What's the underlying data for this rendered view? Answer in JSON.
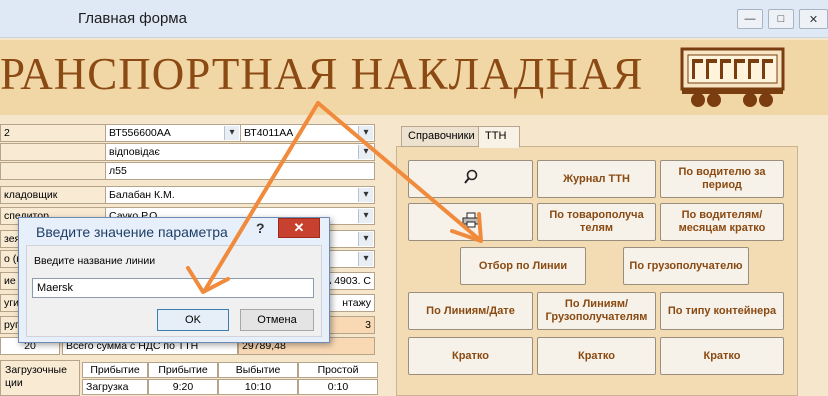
{
  "window": {
    "title": "Главная форма",
    "min": "—",
    "max": "□",
    "close": "✕"
  },
  "banner": {
    "text": "РАНСПОРТНАЯ НАКЛАДНАЯ"
  },
  "form": {
    "r1_label": "2",
    "r1_combo_a": "ВТ556600АА",
    "r1_combo_b": "ВТ4011АА",
    "r2_value": "відповідає",
    "r3_value": "л55",
    "r4_label": "кладовщик",
    "r4_value": "Балабан К.М.",
    "r5_label": "спедитор",
    "r5_value": "Сауко Р.О.",
    "r6_label": "зея",
    "r7_label": "о (гру",
    "r8_label": "ие д",
    "r8_value": "А 4903. С",
    "r9_label": "уги",
    "r9_value": "нтажу",
    "r10_label": "ругт",
    "r10_value": "3",
    "r11_num": "20",
    "r11_text": "Всего сумма с НДС по ТТН",
    "r11_value": "29789,48"
  },
  "table": {
    "left_label_1": "Загрузочные",
    "left_label_2": "ции",
    "headers": [
      "Прибытие",
      "Прибытие",
      "Выбытие",
      "Простой"
    ],
    "row_label": "Загрузка",
    "row_values": [
      "9:20",
      "10:10",
      "0:10"
    ]
  },
  "tabs": [
    "Справочники",
    "ТТН"
  ],
  "buttons": {
    "journal": "Журнал ТТН",
    "by_driver": "По водителю за период",
    "by_consignee": "По товарополуча телям",
    "drivers_months": "По водителям/ месяцам кратко",
    "by_line": "Отбор по Линии",
    "by_consignee2": "По грузополучателю",
    "lines_date": "По Линиям/Дате",
    "lines_consignees": "По Линиям/ Грузополучателям",
    "container_type": "По типу контейнера",
    "short1": "Кратко",
    "short2": "Кратко",
    "short3": "Кратко"
  },
  "dialog": {
    "title": "Введите значение параметра",
    "help": "?",
    "close": "✕",
    "label": "Введите название линии",
    "input_value": "Maersk",
    "ok": "OK",
    "cancel": "Отмена"
  },
  "colors": {
    "banner_text": "#8b4a14",
    "button_text": "#8a4a12",
    "arrow": "#f08a3c"
  }
}
